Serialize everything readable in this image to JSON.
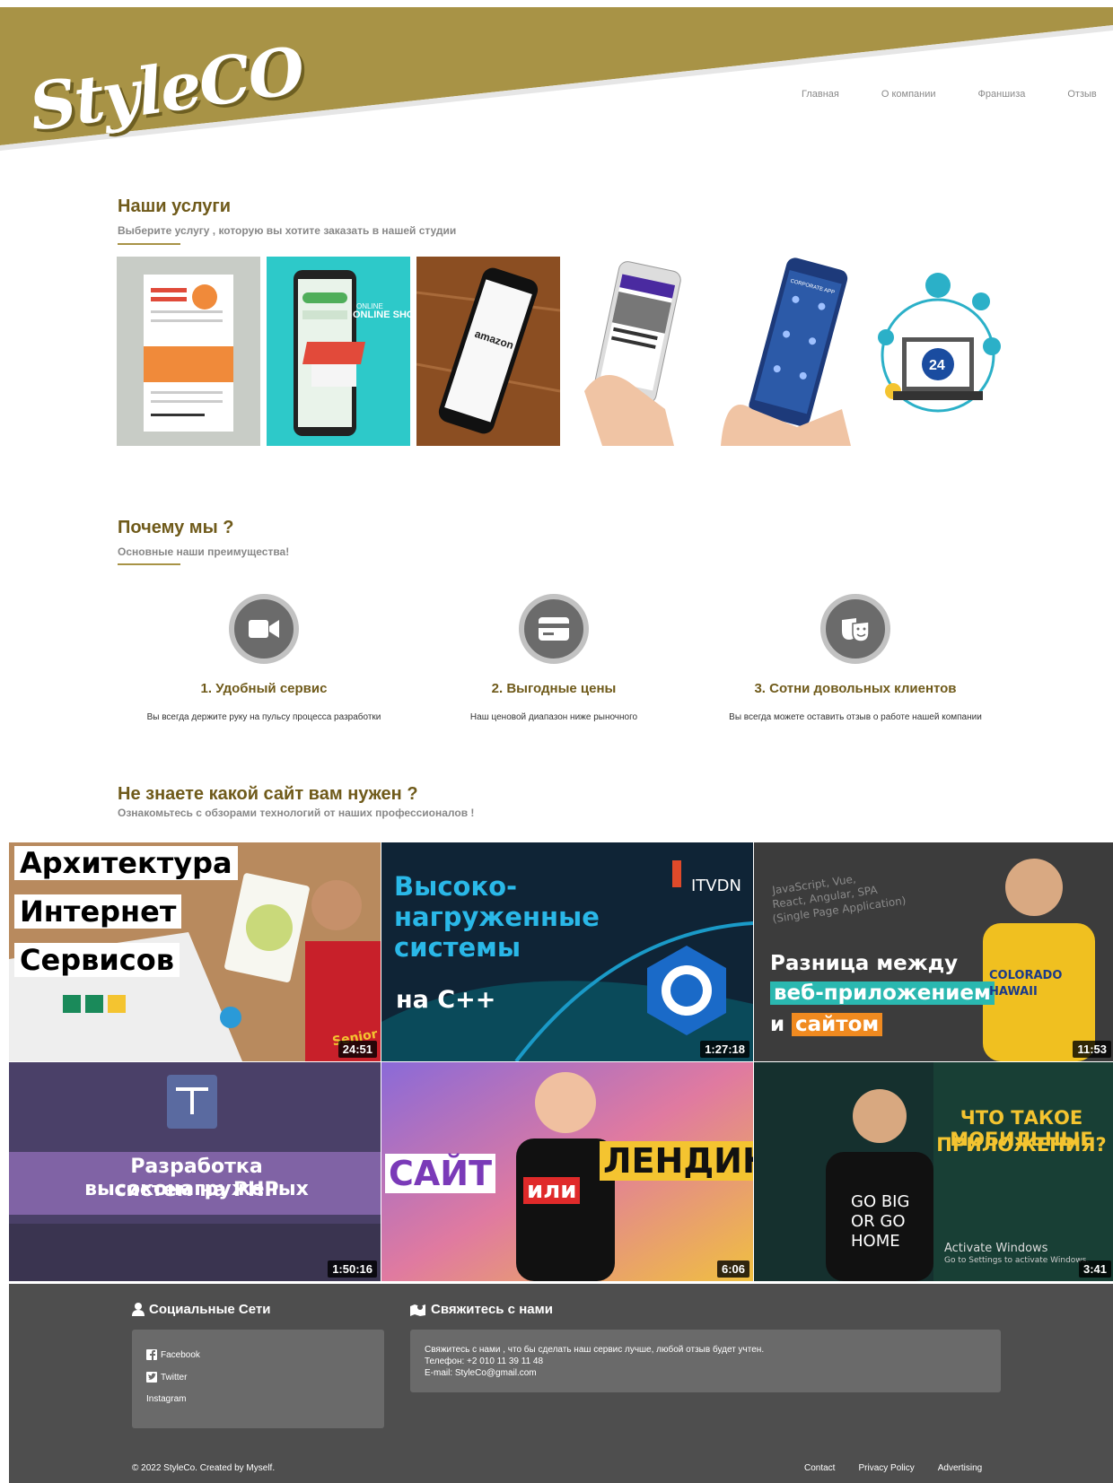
{
  "header": {
    "logo": "StyleCO",
    "nav": [
      "Главная",
      "О компании",
      "Франшиза",
      "Отзыв"
    ],
    "brand_color": "#a89346"
  },
  "services": {
    "title": "Наши услуги",
    "subtitle": "Выберите услугу , которую вы хотите заказать в нашей студии",
    "tiles": [
      {
        "label": "",
        "icon": "landing-page-mockup"
      },
      {
        "label": "ONLINE SHOPPING",
        "icon": "online-shop-phone"
      },
      {
        "label": "amazon",
        "icon": "amazon-phone"
      },
      {
        "label": "",
        "icon": "news-app-phone"
      },
      {
        "label": "CORPORATE APP",
        "icon": "corporate-app-phone"
      },
      {
        "label": "24",
        "icon": "support-24-laptop"
      }
    ]
  },
  "why": {
    "title": "Почему мы ?",
    "subtitle": "Основные наши преимущества!",
    "features": [
      {
        "icon": "video-camera-icon",
        "title": "1. Удобный сервис",
        "text": "Вы всегда держите руку на пульсу процесса разработки"
      },
      {
        "icon": "credit-card-icon",
        "title": "2. Выгодные цены",
        "text": "Наш ценовой диапазон ниже рыночного"
      },
      {
        "icon": "theater-masks-icon",
        "title": "3. Сотни довольных клиентов",
        "text": "Вы всегда можете оставить отзыв о работе нашей компании"
      }
    ]
  },
  "videos": {
    "title": "Не знаете какой сайт вам нужен ?",
    "subtitle": "Ознакомьтесь с обзорами технологий от наших профессионалов !",
    "items": [
      {
        "lines": [
          "Архитектура",
          "Интернет",
          "Сервисов"
        ],
        "badge": "Senior",
        "duration": "24:51"
      },
      {
        "lines": [
          "Высоко-",
          "нагруженные",
          "системы",
          "на С++"
        ],
        "badge": "ITVDN",
        "duration": "1:27:18"
      },
      {
        "lines": [
          "JavaScript, Vue,",
          "React, Angular, SPA",
          "(Single Page Application)",
          "Разница между",
          "веб-приложением",
          "и",
          "сайтом"
        ],
        "badge": "COLORADO HAWAII",
        "duration": "11:53"
      },
      {
        "lines": [
          "Разработка высоконагруженых",
          "систем на PHP"
        ],
        "badge": "",
        "duration": "1:50:16"
      },
      {
        "lines": [
          "САЙТ",
          "или",
          "ЛЕНДИНГ"
        ],
        "badge": "",
        "duration": "6:06"
      },
      {
        "lines": [
          "ЧТО ТАКОЕ МОБИЛЬНЫЕ",
          "ПРИЛОЖЕНИЯ?",
          "GO BIG OR GO HOME",
          "Activate Windows",
          "Go to Settings to activate Windows."
        ],
        "badge": "",
        "duration": "3:41"
      }
    ]
  },
  "footer": {
    "social_title": "Социальные Сети",
    "social": [
      "Facebook",
      "Twitter",
      "Instagram"
    ],
    "contact_title": "Свяжитесь с нами",
    "contact_lines": [
      "Свяжитесь с нами , что бы сделать наш сервис лучше, любой отзыв будет учтен.",
      "Телефон: +2 010 11 39 11 48",
      "E-mail: StyleCo@gmail.com"
    ],
    "copyright": "© 2022 StyleCo. Created by Myself.",
    "links": [
      "Contact",
      "Privacy Policy",
      "Advertising"
    ]
  }
}
